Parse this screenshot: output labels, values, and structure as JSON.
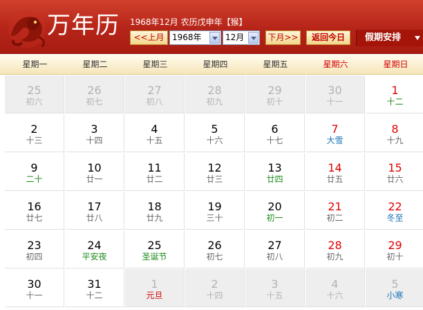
{
  "header": {
    "title": "万年历",
    "info_line": "1968年12月 农历戊申年【猴】",
    "prev_month_label": "<<上月",
    "year_value": "1968年",
    "month_value": "12月",
    "next_month_label": "下月>>",
    "today_label": "返回今日",
    "holiday_label": "假期安排"
  },
  "weekdays": [
    {
      "label": "星期一",
      "weekend": false
    },
    {
      "label": "星期二",
      "weekend": false
    },
    {
      "label": "星期三",
      "weekend": false
    },
    {
      "label": "星期四",
      "weekend": false
    },
    {
      "label": "星期五",
      "weekend": false
    },
    {
      "label": "星期六",
      "weekend": true
    },
    {
      "label": "星期日",
      "weekend": true
    }
  ],
  "weeks": [
    [
      {
        "day": "25",
        "lunar": "初六",
        "dim": true
      },
      {
        "day": "26",
        "lunar": "初七",
        "dim": true
      },
      {
        "day": "27",
        "lunar": "初八",
        "dim": true
      },
      {
        "day": "28",
        "lunar": "初九",
        "dim": true
      },
      {
        "day": "29",
        "lunar": "初十",
        "dim": true
      },
      {
        "day": "30",
        "lunar": "十一",
        "dim": true
      },
      {
        "day": "1",
        "lunar": "十二",
        "kind": "festival"
      }
    ],
    [
      {
        "day": "2",
        "lunar": "十三"
      },
      {
        "day": "3",
        "lunar": "十四"
      },
      {
        "day": "4",
        "lunar": "十五"
      },
      {
        "day": "5",
        "lunar": "十六"
      },
      {
        "day": "6",
        "lunar": "十七"
      },
      {
        "day": "7",
        "lunar": "大雪",
        "kind": "term"
      },
      {
        "day": "8",
        "lunar": "十九"
      }
    ],
    [
      {
        "day": "9",
        "lunar": "二十",
        "kind": "festival"
      },
      {
        "day": "10",
        "lunar": "廿一"
      },
      {
        "day": "11",
        "lunar": "廿二"
      },
      {
        "day": "12",
        "lunar": "廿三"
      },
      {
        "day": "13",
        "lunar": "廿四",
        "kind": "festival"
      },
      {
        "day": "14",
        "lunar": "廿五"
      },
      {
        "day": "15",
        "lunar": "廿六"
      }
    ],
    [
      {
        "day": "16",
        "lunar": "廿七"
      },
      {
        "day": "17",
        "lunar": "廿八"
      },
      {
        "day": "18",
        "lunar": "廿九"
      },
      {
        "day": "19",
        "lunar": "三十"
      },
      {
        "day": "20",
        "lunar": "初一",
        "kind": "festival"
      },
      {
        "day": "21",
        "lunar": "初二"
      },
      {
        "day": "22",
        "lunar": "冬至",
        "kind": "term"
      }
    ],
    [
      {
        "day": "23",
        "lunar": "初四"
      },
      {
        "day": "24",
        "lunar": "平安夜",
        "kind": "festival"
      },
      {
        "day": "25",
        "lunar": "圣诞节",
        "kind": "festival"
      },
      {
        "day": "26",
        "lunar": "初七"
      },
      {
        "day": "27",
        "lunar": "初八"
      },
      {
        "day": "28",
        "lunar": "初九"
      },
      {
        "day": "29",
        "lunar": "初十"
      }
    ],
    [
      {
        "day": "30",
        "lunar": "十一"
      },
      {
        "day": "31",
        "lunar": "十二"
      },
      {
        "day": "1",
        "lunar": "元旦",
        "dim": true,
        "kind": "holiday"
      },
      {
        "day": "2",
        "lunar": "十四",
        "dim": true
      },
      {
        "day": "3",
        "lunar": "十五",
        "dim": true
      },
      {
        "day": "4",
        "lunar": "十六",
        "dim": true
      },
      {
        "day": "5",
        "lunar": "小寒",
        "dim": true,
        "kind": "term"
      }
    ]
  ]
}
